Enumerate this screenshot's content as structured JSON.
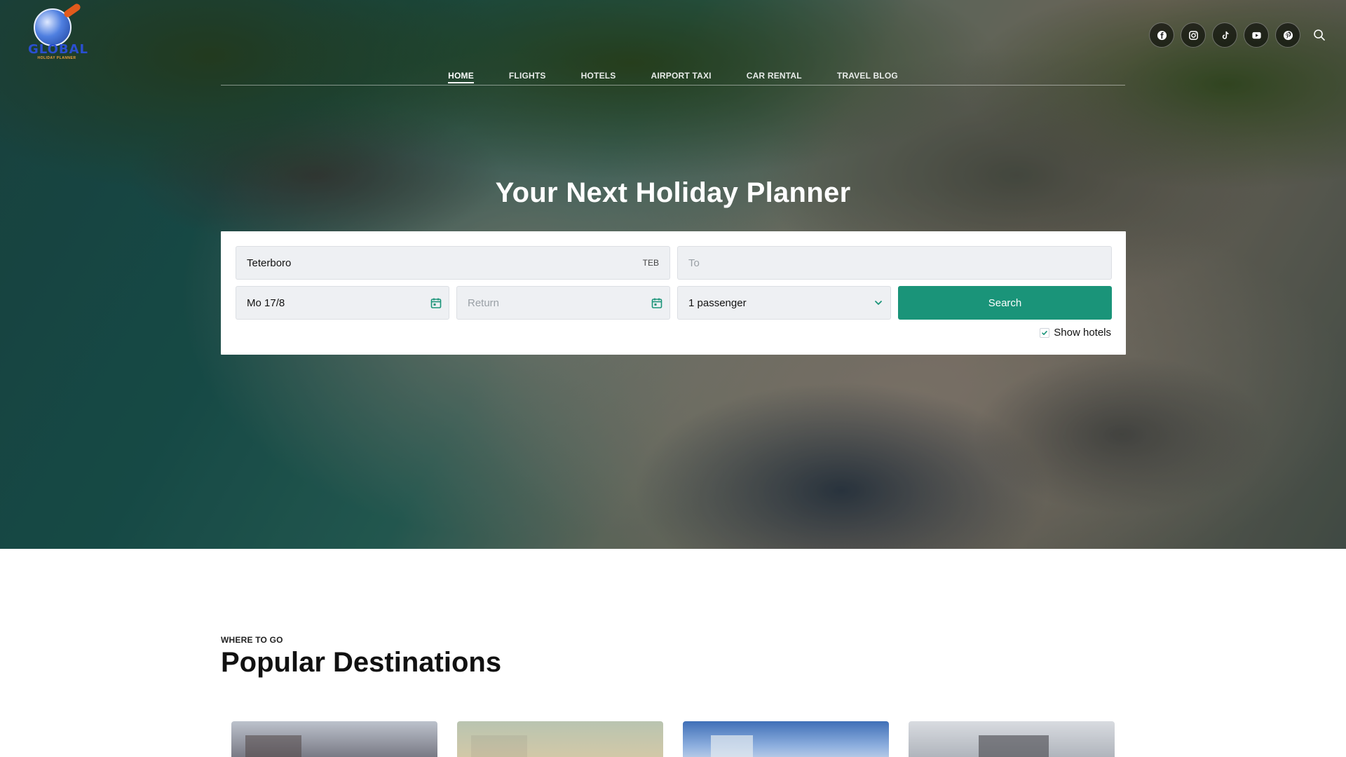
{
  "brand": {
    "word": "GLOBAL",
    "sub": "HOLIDAY PLANNER"
  },
  "nav": {
    "items": [
      {
        "label": "HOME",
        "active": true
      },
      {
        "label": "FLIGHTS",
        "active": false
      },
      {
        "label": "HOTELS",
        "active": false
      },
      {
        "label": "AIRPORT TAXI",
        "active": false
      },
      {
        "label": "CAR RENTAL",
        "active": false
      },
      {
        "label": "TRAVEL BLOG",
        "active": false
      }
    ]
  },
  "socials": [
    "facebook-icon",
    "instagram-icon",
    "tiktok-icon",
    "youtube-icon",
    "pinterest-icon"
  ],
  "hero": {
    "title": "Your Next Holiday Planner"
  },
  "search": {
    "from_value": "Teterboro",
    "from_code": "TEB",
    "to_placeholder": "To",
    "depart_value": "Mo 17/8",
    "return_placeholder": "Return",
    "passengers_value": "1 passenger",
    "search_label": "Search",
    "show_hotels_label": "Show hotels",
    "show_hotels_checked": true
  },
  "section": {
    "kicker": "WHERE TO GO",
    "title": "Popular Destinations"
  },
  "colors": {
    "accent": "#1a9479",
    "calendar_icon": "#1a9479"
  }
}
